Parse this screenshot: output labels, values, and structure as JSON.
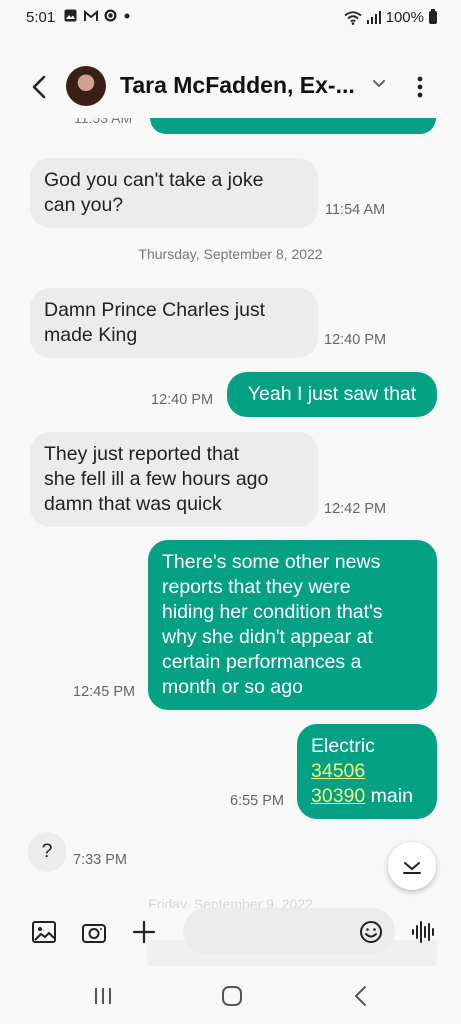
{
  "status_bar": {
    "time": "5:01",
    "left_icons": [
      "gallery-icon",
      "gmail-icon",
      "sync-icon",
      "dot"
    ],
    "battery": "100%"
  },
  "header": {
    "contact_name": "Tara McFadden, Ex-...",
    "icons": [
      "back-arrow-icon",
      "chevron-down-icon",
      "more-vertical-icon"
    ]
  },
  "messages": {
    "partial_time": "11:53 AM",
    "items": [
      {
        "dir": "in",
        "text_lines": [
          "God you can't take a joke",
          "can you?"
        ],
        "time": "11:54 AM"
      },
      {
        "date": "Thursday, September 8, 2022"
      },
      {
        "dir": "in",
        "text_lines": [
          "Damn Prince Charles just",
          "made King"
        ],
        "time": "12:40 PM"
      },
      {
        "dir": "out",
        "text_lines": [
          "Yeah I just saw that"
        ],
        "time": "12:40 PM"
      },
      {
        "dir": "in",
        "text_lines": [
          "They just reported that",
          "she fell ill a few hours ago",
          "damn that was quick"
        ],
        "time": "12:42 PM"
      },
      {
        "dir": "out",
        "text_lines": [
          "There's some other news",
          "reports that they were",
          "hiding her condition that's",
          "why she didn't appear at",
          "certain performances a",
          "month or so ago"
        ],
        "time": "12:45 PM"
      },
      {
        "dir": "out",
        "prefix": "Electric",
        "link1": "34506",
        "link2": "30390",
        "suffix": " main",
        "time": "6:55 PM"
      },
      {
        "dir": "in",
        "text_lines": [
          "?"
        ],
        "time": "7:33 PM"
      }
    ],
    "faded_date": "Friday, September 9, 2022"
  },
  "input_bar": {
    "placeholder": "",
    "icons": [
      "gallery-icon",
      "camera-icon",
      "plus-icon",
      "emoji-icon",
      "voice-icon"
    ]
  },
  "colors": {
    "outgoing": "#04a184",
    "incoming": "#ececec",
    "link": "#f2ef7d",
    "background": "#f8f8f8"
  }
}
